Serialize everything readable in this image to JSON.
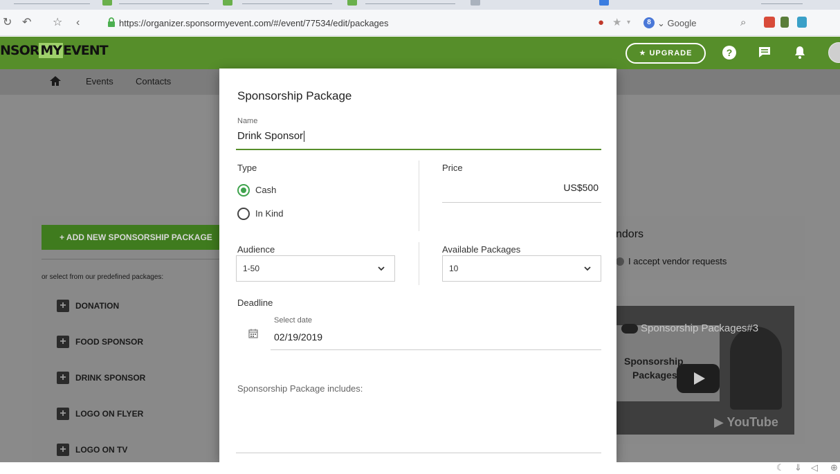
{
  "browser": {
    "url": "https://organizer.sponsormyevent.com/#/event/77534/edit/packages",
    "search_engine": "Google"
  },
  "header": {
    "logo_left": "NSOR",
    "logo_my": "MY",
    "logo_right": "EVENT",
    "upgrade_label": "★ UPGRADE",
    "brand_color": "#568e2a"
  },
  "nav": {
    "items": [
      {
        "label": "Events"
      },
      {
        "label": "Contacts"
      }
    ]
  },
  "packages_panel": {
    "add_button_label": "+ ADD NEW SPONSORSHIP PACKAGE",
    "predefined_label": "or select from our predefined packages:",
    "items": [
      {
        "label": "DONATION"
      },
      {
        "label": "FOOD SPONSOR"
      },
      {
        "label": "DRINK SPONSOR"
      },
      {
        "label": "LOGO ON FLYER"
      },
      {
        "label": "LOGO ON TV"
      }
    ]
  },
  "vendors_panel": {
    "title": "ndors",
    "toggle_label": "I accept vendor requests"
  },
  "video": {
    "title": "Sponsorship Packages#3",
    "slide_text_line1": "Sponsorship",
    "slide_text_line2": "Packages",
    "badge": "▶ YouTube"
  },
  "modal": {
    "title": "Sponsorship Package",
    "name_label": "Name",
    "name_value": "Drink Sponsor",
    "type_label": "Type",
    "type_options": [
      {
        "label": "Cash",
        "checked": true
      },
      {
        "label": "In Kind",
        "checked": false
      }
    ],
    "price_label": "Price",
    "price_value": "US$500",
    "audience_label": "Audience",
    "audience_value": "1-50",
    "available_label": "Available Packages",
    "available_value": "10",
    "deadline_label": "Deadline",
    "date_sublabel": "Select date",
    "date_value": "02/19/2019",
    "includes_placeholder": "Sponsorship Package includes:"
  }
}
